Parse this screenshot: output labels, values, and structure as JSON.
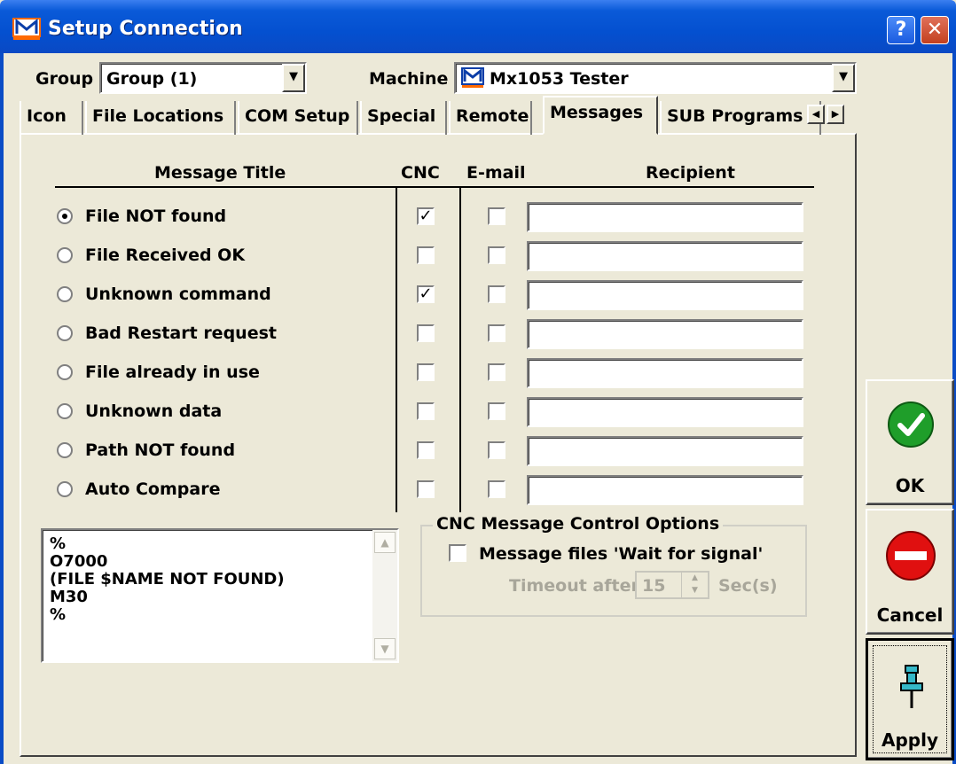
{
  "window": {
    "title": "Setup Connection",
    "help_btn": "?",
    "close_btn": "✕"
  },
  "group": {
    "label": "Group",
    "value": "Group (1)"
  },
  "machine": {
    "label": "Machine",
    "value": "Mx1053 Tester"
  },
  "tabs": [
    "Icon",
    "File Locations",
    "COM Setup",
    "Special",
    "Remote",
    "Messages",
    "SUB Programs"
  ],
  "active_tab": "Messages",
  "columns": {
    "title": "Message Title",
    "cnc": "CNC",
    "email": "E-mail",
    "recipient": "Recipient"
  },
  "messages": [
    {
      "label": "File NOT found",
      "selected": true,
      "cnc": true,
      "email": false,
      "recipient": ""
    },
    {
      "label": "File Received OK",
      "selected": false,
      "cnc": false,
      "email": false,
      "recipient": ""
    },
    {
      "label": "Unknown command",
      "selected": false,
      "cnc": true,
      "email": false,
      "recipient": ""
    },
    {
      "label": "Bad Restart request",
      "selected": false,
      "cnc": false,
      "email": false,
      "recipient": ""
    },
    {
      "label": "File already in use",
      "selected": false,
      "cnc": false,
      "email": false,
      "recipient": ""
    },
    {
      "label": "Unknown data",
      "selected": false,
      "cnc": false,
      "email": false,
      "recipient": ""
    },
    {
      "label": "Path NOT found",
      "selected": false,
      "cnc": false,
      "email": false,
      "recipient": ""
    },
    {
      "label": "Auto Compare",
      "selected": false,
      "cnc": false,
      "email": false,
      "recipient": ""
    }
  ],
  "message_text": "%\nO7000\n(FILE $NAME NOT FOUND)\nM30\n%",
  "cnc_options": {
    "title": "CNC Message Control Options",
    "wait_label": "Message files 'Wait for signal'",
    "wait_checked": false,
    "timeout_label": "Timeout after",
    "timeout_value": "15",
    "timeout_unit": "Sec(s)"
  },
  "buttons": {
    "ok": "OK",
    "cancel": "Cancel",
    "apply": "Apply"
  },
  "colors": {
    "title_bar": "#0450d0",
    "ok_icon": "#1f9e2a",
    "cancel_icon": "#e01010",
    "apply_icon": "#35b8c8"
  }
}
